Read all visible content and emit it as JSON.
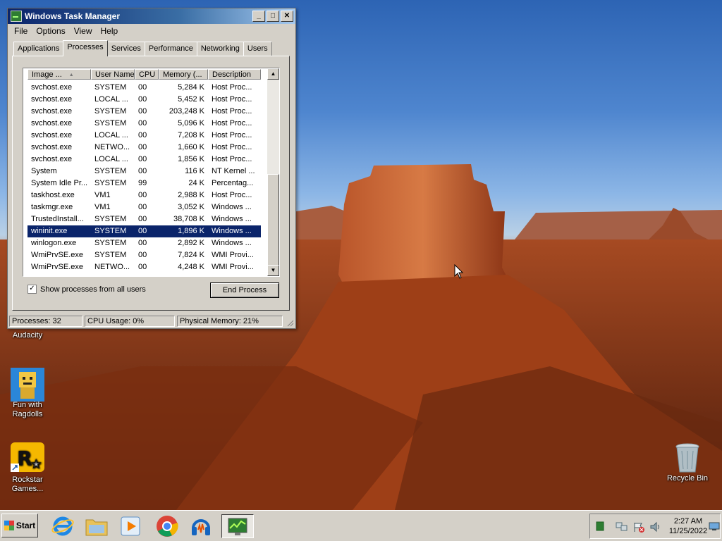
{
  "window": {
    "title": "Windows Task Manager",
    "menu": [
      "File",
      "Options",
      "View",
      "Help"
    ],
    "tabs": [
      "Applications",
      "Processes",
      "Services",
      "Performance",
      "Networking",
      "Users"
    ],
    "active_tab": "Processes",
    "columns": [
      "Image ...",
      "User Name",
      "CPU",
      "Memory (...",
      "Description"
    ],
    "rows": [
      {
        "image": "svchost.exe",
        "user": "SYSTEM",
        "cpu": "00",
        "mem": "5,284 K",
        "desc": "Host Proc..."
      },
      {
        "image": "svchost.exe",
        "user": "LOCAL ...",
        "cpu": "00",
        "mem": "5,452 K",
        "desc": "Host Proc..."
      },
      {
        "image": "svchost.exe",
        "user": "SYSTEM",
        "cpu": "00",
        "mem": "203,248 K",
        "desc": "Host Proc..."
      },
      {
        "image": "svchost.exe",
        "user": "SYSTEM",
        "cpu": "00",
        "mem": "5,096 K",
        "desc": "Host Proc..."
      },
      {
        "image": "svchost.exe",
        "user": "LOCAL ...",
        "cpu": "00",
        "mem": "7,208 K",
        "desc": "Host Proc..."
      },
      {
        "image": "svchost.exe",
        "user": "NETWO...",
        "cpu": "00",
        "mem": "1,660 K",
        "desc": "Host Proc..."
      },
      {
        "image": "svchost.exe",
        "user": "LOCAL ...",
        "cpu": "00",
        "mem": "1,856 K",
        "desc": "Host Proc..."
      },
      {
        "image": "System",
        "user": "SYSTEM",
        "cpu": "00",
        "mem": "116 K",
        "desc": "NT Kernel ..."
      },
      {
        "image": "System Idle Pr...",
        "user": "SYSTEM",
        "cpu": "99",
        "mem": "24 K",
        "desc": "Percentag..."
      },
      {
        "image": "taskhost.exe",
        "user": "VM1",
        "cpu": "00",
        "mem": "2,988 K",
        "desc": "Host Proc..."
      },
      {
        "image": "taskmgr.exe",
        "user": "VM1",
        "cpu": "00",
        "mem": "3,052 K",
        "desc": "Windows ..."
      },
      {
        "image": "TrustedInstall...",
        "user": "SYSTEM",
        "cpu": "00",
        "mem": "38,708 K",
        "desc": "Windows ..."
      },
      {
        "image": "wininit.exe",
        "user": "SYSTEM",
        "cpu": "00",
        "mem": "1,896 K",
        "desc": "Windows ..."
      },
      {
        "image": "winlogon.exe",
        "user": "SYSTEM",
        "cpu": "00",
        "mem": "2,892 K",
        "desc": "Windows ..."
      },
      {
        "image": "WmiPrvSE.exe",
        "user": "SYSTEM",
        "cpu": "00",
        "mem": "7,824 K",
        "desc": "WMI Provi..."
      },
      {
        "image": "WmiPrvSE.exe",
        "user": "NETWO...",
        "cpu": "00",
        "mem": "4,248 K",
        "desc": "WMI Provi..."
      }
    ],
    "selected_row": 12,
    "show_all_label": "Show processes from all users",
    "show_all_checked": "✓",
    "end_process_label": "End Process",
    "status": {
      "processes": "Processes: 32",
      "cpu": "CPU Usage: 0%",
      "memory": "Physical Memory: 21%"
    }
  },
  "desktop_icons": {
    "audacity": "Audacity",
    "ragdolls": "Fun with Ragdolls",
    "rockstar": "Rockstar Games...",
    "recycle": "Recycle Bin"
  },
  "taskbar": {
    "start_label": "Start",
    "time": "2:27 AM",
    "date": "11/25/2022"
  }
}
